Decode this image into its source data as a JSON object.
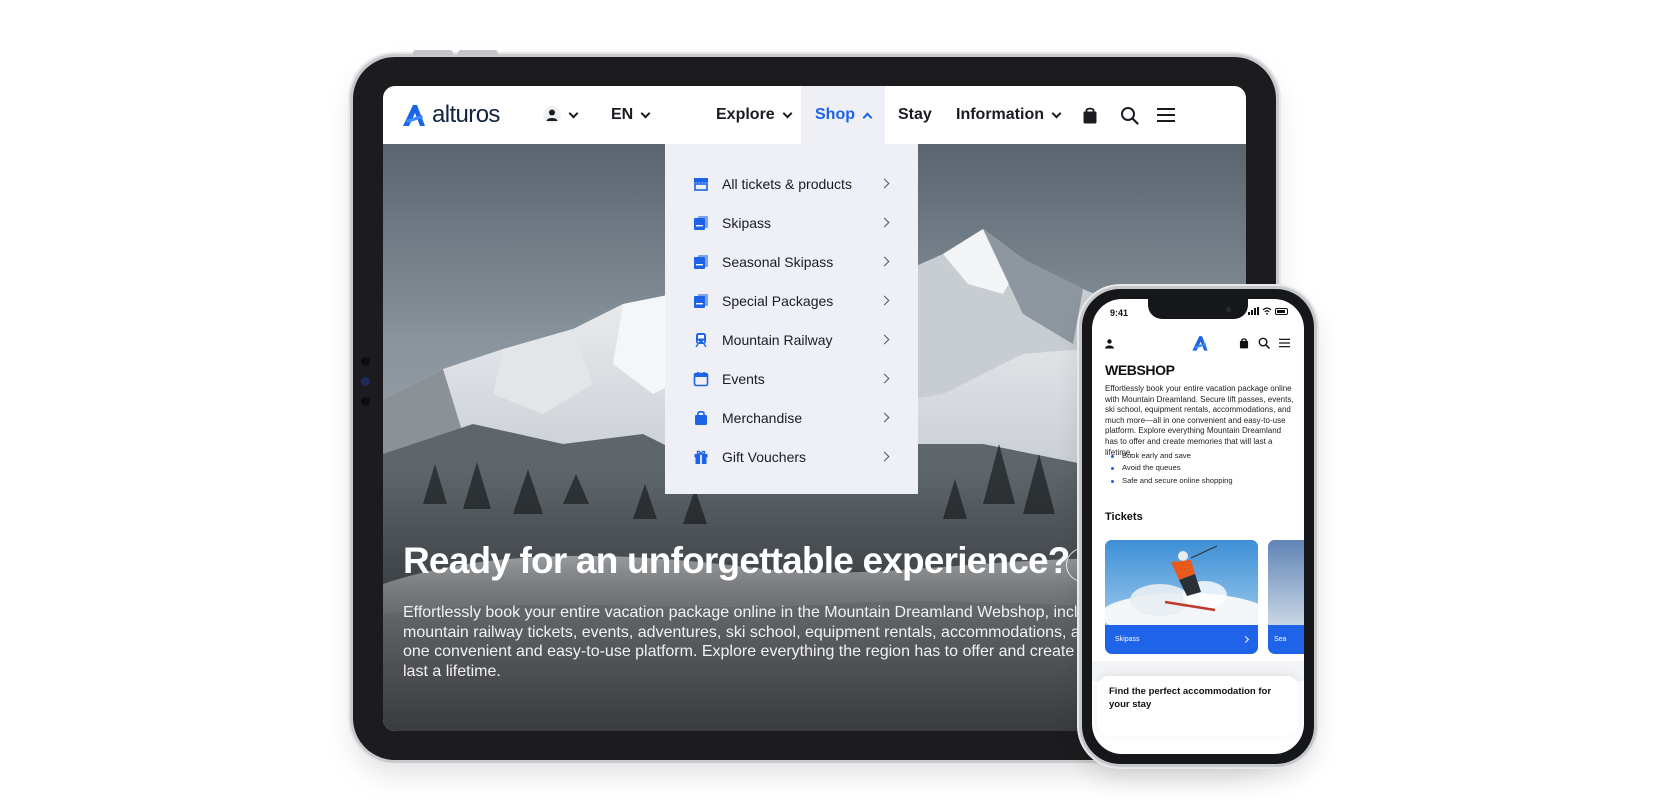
{
  "tablet": {
    "nav": {
      "logo_text": "alturos",
      "language": "EN",
      "items": [
        {
          "label": "Explore",
          "has_dropdown": true
        },
        {
          "label": "Shop",
          "has_dropdown": true,
          "active": true
        },
        {
          "label": "Stay",
          "has_dropdown": false
        },
        {
          "label": "Information",
          "has_dropdown": true
        }
      ],
      "icons": [
        "user-icon",
        "shopping-bag-icon",
        "search-icon",
        "hamburger-menu-icon"
      ]
    },
    "shop_dropdown": {
      "items": [
        {
          "label": "All tickets & products",
          "icon": "shop-icon"
        },
        {
          "label": "Skipass",
          "icon": "ticket-icon"
        },
        {
          "label": "Seasonal Skipass",
          "icon": "ticket-icon"
        },
        {
          "label": "Special Packages",
          "icon": "ticket-icon"
        },
        {
          "label": "Mountain Railway",
          "icon": "train-icon"
        },
        {
          "label": "Events",
          "icon": "calendar-icon"
        },
        {
          "label": "Merchandise",
          "icon": "bag-icon"
        },
        {
          "label": "Gift Vouchers",
          "icon": "gift-icon"
        }
      ]
    },
    "hero": {
      "title": "Ready for an unforgettable experience?",
      "text_lines": [
        "Effortlessly book your entire vacation package online in the Mountain Dreamland Webshop, inclu",
        "mountain railway tickets, events, adventures, ski school, equipment rentals, accommodations, an",
        "one convenient and easy-to-use platform. Explore everything the region has to offer and create m",
        "last a lifetime."
      ]
    }
  },
  "phone": {
    "status": {
      "time": "9:41"
    },
    "title": "WEBSHOP",
    "intro": "Effortlessly book your entire vacation package online with Mountain Dreamland. Secure lift passes, events, ski school, equipment rentals, accommodations, and much more—all in one convenient and easy-to-use platform. Explore everything Mountain Dreamland has to offer and create memories that will last a lifetime.",
    "bullets": [
      "Book early and save",
      "Avoid the queues",
      "Safe and secure online shopping"
    ],
    "section_title": "Tickets",
    "cards": [
      {
        "label": "Skipass"
      },
      {
        "label": "Sea"
      }
    ],
    "accommodation_text": "Find the perfect accommodation for your stay"
  },
  "colors": {
    "brand_blue": "#1c63e6",
    "menu_bg": "#eef0f5",
    "text_dark": "#1b1c22"
  }
}
